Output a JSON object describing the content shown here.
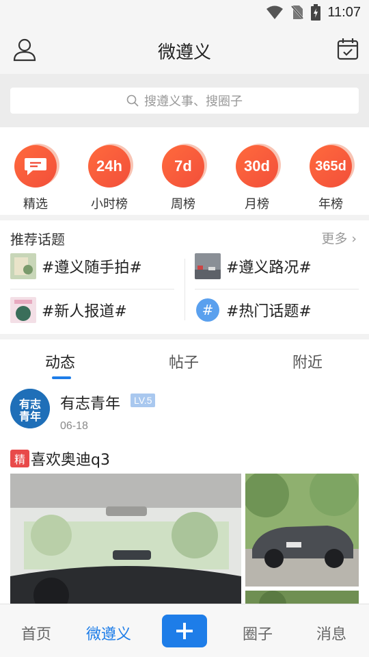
{
  "status_bar": {
    "time": "11:07"
  },
  "header": {
    "title": "微遵义",
    "user_icon": "user-icon",
    "calendar_icon": "calendar-check-icon"
  },
  "search": {
    "placeholder": "搜遵义事、搜圈子"
  },
  "ranks": [
    {
      "badge": "",
      "icon": "chat-bubble-icon",
      "label": "精选"
    },
    {
      "badge": "24h",
      "label": "小时榜"
    },
    {
      "badge": "7d",
      "label": "周榜"
    },
    {
      "badge": "30d",
      "label": "月榜"
    },
    {
      "badge": "365d",
      "label": "年榜"
    }
  ],
  "topics": {
    "title": "推荐话题",
    "more": "更多",
    "items": [
      {
        "label": "#遵义随手拍#"
      },
      {
        "label": "#遵义路况#"
      },
      {
        "label": "#新人报道#"
      },
      {
        "label": "#热门话题#",
        "icon": "hash-icon"
      }
    ]
  },
  "feed": {
    "tabs": [
      "动态",
      "帖子",
      "附近"
    ],
    "active_tab": "动态",
    "post": {
      "author": "有志青年",
      "level": "LV.5",
      "date": "06-18",
      "avatar_text": "有志青年",
      "badge": "精",
      "title": "喜欢奥迪q3"
    }
  },
  "bottom_nav": {
    "items": [
      "首页",
      "微遵义",
      "圈子",
      "消息"
    ],
    "active": "微遵义"
  },
  "colors": {
    "accent": "#1e7de8",
    "rank_orange": "#f24f3a",
    "badge_red": "#e84a4a"
  }
}
